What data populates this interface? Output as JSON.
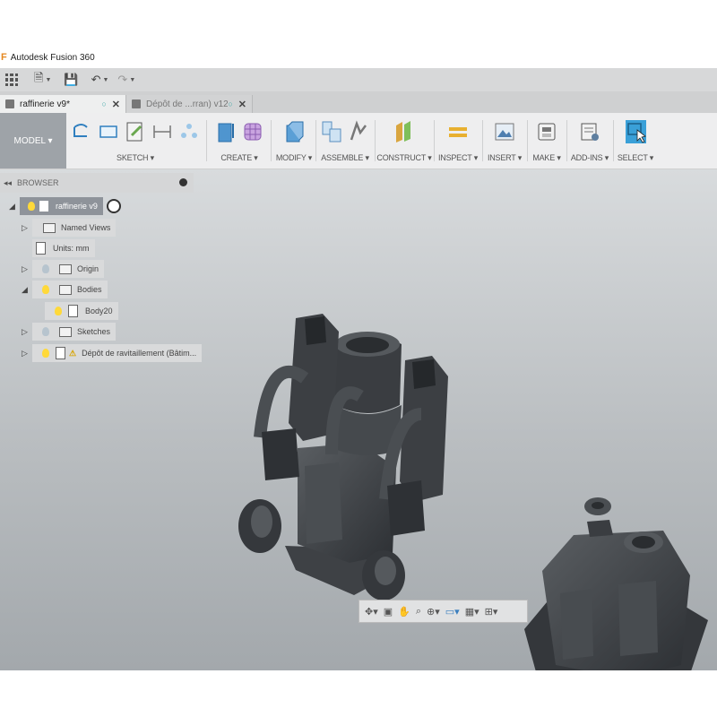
{
  "window": {
    "title": "Autodesk Fusion 360"
  },
  "tabs": [
    {
      "label": "raffinerie v9*",
      "active": true
    },
    {
      "label": "Dépôt de ...rran) v12",
      "active": false
    }
  ],
  "toolbar": {
    "workspace": "MODEL ▾",
    "groups": [
      {
        "label": "SKETCH ▾"
      },
      {
        "label": "CREATE ▾"
      },
      {
        "label": "MODIFY ▾"
      },
      {
        "label": "ASSEMBLE ▾"
      },
      {
        "label": "CONSTRUCT ▾"
      },
      {
        "label": "INSPECT ▾"
      },
      {
        "label": "INSERT ▾"
      },
      {
        "label": "MAKE ▾"
      },
      {
        "label": "ADD-INS ▾"
      },
      {
        "label": "SELECT ▾"
      }
    ]
  },
  "browser": {
    "title": "BROWSER",
    "items": [
      {
        "label": "raffinerie v9"
      },
      {
        "label": "Named Views"
      },
      {
        "label": "Units: mm"
      },
      {
        "label": "Origin"
      },
      {
        "label": "Bodies"
      },
      {
        "label": "Body20"
      },
      {
        "label": "Sketches"
      },
      {
        "label": "Dépôt de ravitaillement (Bâtim..."
      }
    ]
  },
  "colors": {
    "accent": "#3aa0d8",
    "model": "#3c3f43",
    "viewport_top": "#d8dbdd",
    "viewport_bottom": "#a3a8ac"
  }
}
